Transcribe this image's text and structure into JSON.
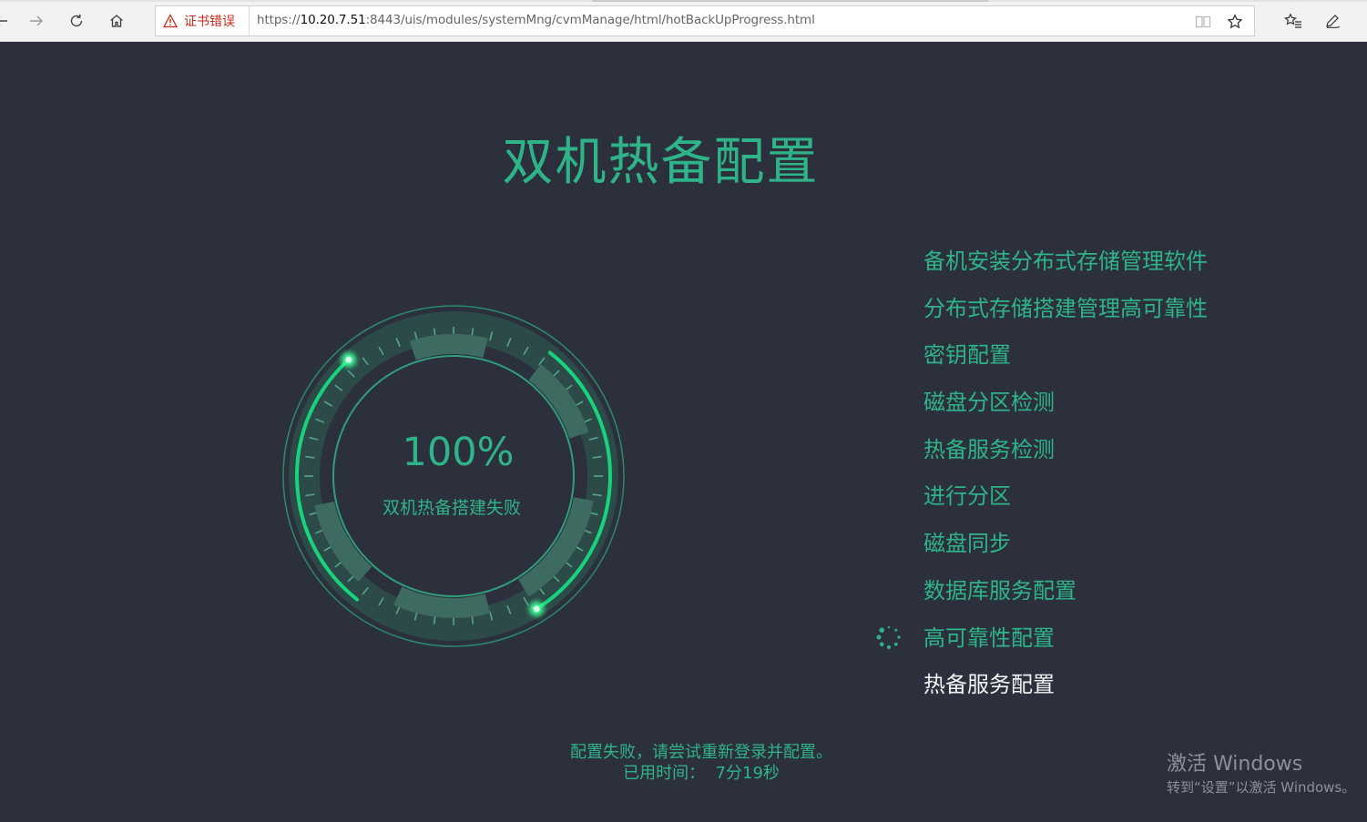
{
  "browser": {
    "cert_error_label": "证书错误",
    "url_prefix": "https://",
    "url_host": "10.20.7.51",
    "url_rest": ":8443/uis/modules/systemMng/cvmManage/html/hotBackUpProgress.html"
  },
  "page": {
    "title": "双机热备配置",
    "progress": {
      "percent_label": "100%",
      "percent_value": 100,
      "status": "双机热备搭建失败"
    },
    "steps": [
      {
        "label": "备机安装分布式存储管理软件",
        "state": "done"
      },
      {
        "label": "分布式存储搭建管理高可靠性",
        "state": "done"
      },
      {
        "label": "密钥配置",
        "state": "done"
      },
      {
        "label": "磁盘分区检测",
        "state": "done"
      },
      {
        "label": "热备服务检测",
        "state": "done"
      },
      {
        "label": "进行分区",
        "state": "done"
      },
      {
        "label": "磁盘同步",
        "state": "done"
      },
      {
        "label": "数据库服务配置",
        "state": "done"
      },
      {
        "label": "高可靠性配置",
        "state": "running"
      },
      {
        "label": "热备服务配置",
        "state": "pending"
      }
    ],
    "footer": {
      "message": "配置失败，请尝试重新登录并配置。",
      "elapsed_label": "已用时间：",
      "elapsed_value": "7分19秒"
    }
  },
  "watermark": {
    "line1": "激活 Windows",
    "line2": "转到“设置”以激活 Windows。"
  },
  "colors": {
    "background": "#2b303c",
    "accent": "#2fb489",
    "accent_bright": "#19d27e",
    "pending_text": "#f2f2f2",
    "error": "#c42b1c"
  }
}
